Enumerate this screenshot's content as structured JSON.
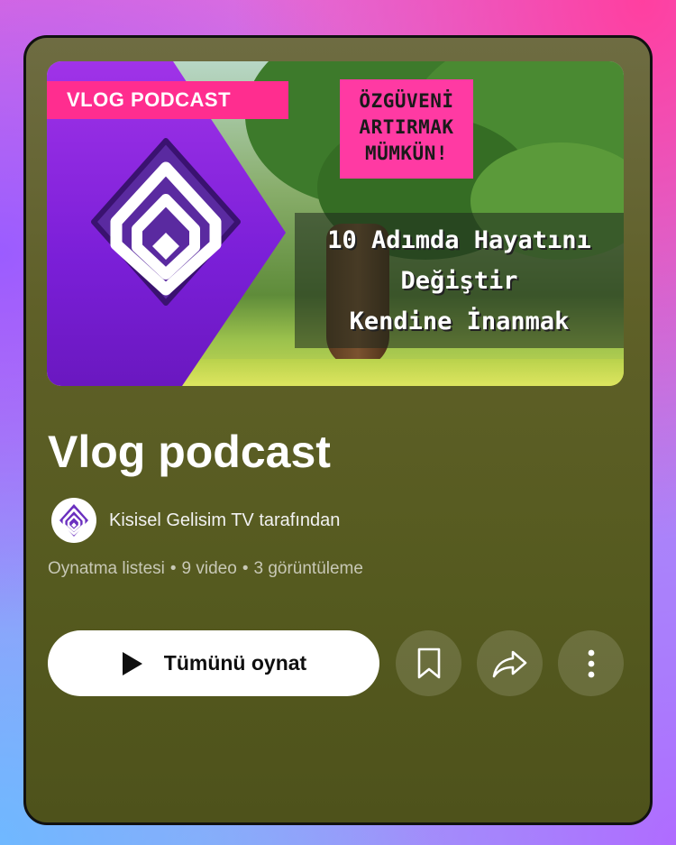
{
  "thumbnail": {
    "badge": "VLOG PODCAST",
    "pink_lines": [
      "ÖZGÜVENİ",
      "ARTIRMAK",
      "MÜMKÜN!"
    ],
    "headline_lines": [
      "10 Adımda Hayatını",
      "Değiştir",
      "Kendine İnanmak"
    ]
  },
  "playlist": {
    "title": "Vlog podcast",
    "channel": "Kisisel Gelisim TV tarafından",
    "meta": {
      "type": "Oynatma listesi",
      "videos": "9 video",
      "views": "3 görüntüleme"
    }
  },
  "actions": {
    "play_all_label": "Tümünü oynat",
    "icons": {
      "play": "play-icon",
      "save": "bookmark-icon",
      "share": "share-icon",
      "more": "more-vertical-icon"
    }
  },
  "colors": {
    "badge_pink": "#ff2d8f",
    "accent_purple": "#7b1fd8",
    "card_bg": "#5f6028"
  }
}
